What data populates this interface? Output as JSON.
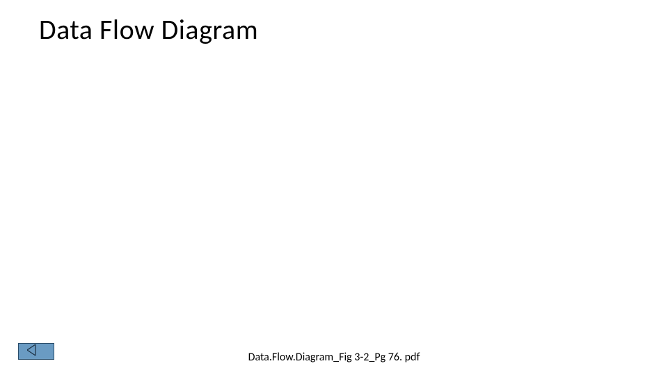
{
  "slide": {
    "title": "Data Flow Diagram"
  },
  "footer": {
    "filename": "Data.Flow.Diagram_Fig 3-2_Pg 76. pdf"
  },
  "nav": {
    "back_button_name": "back-button"
  }
}
